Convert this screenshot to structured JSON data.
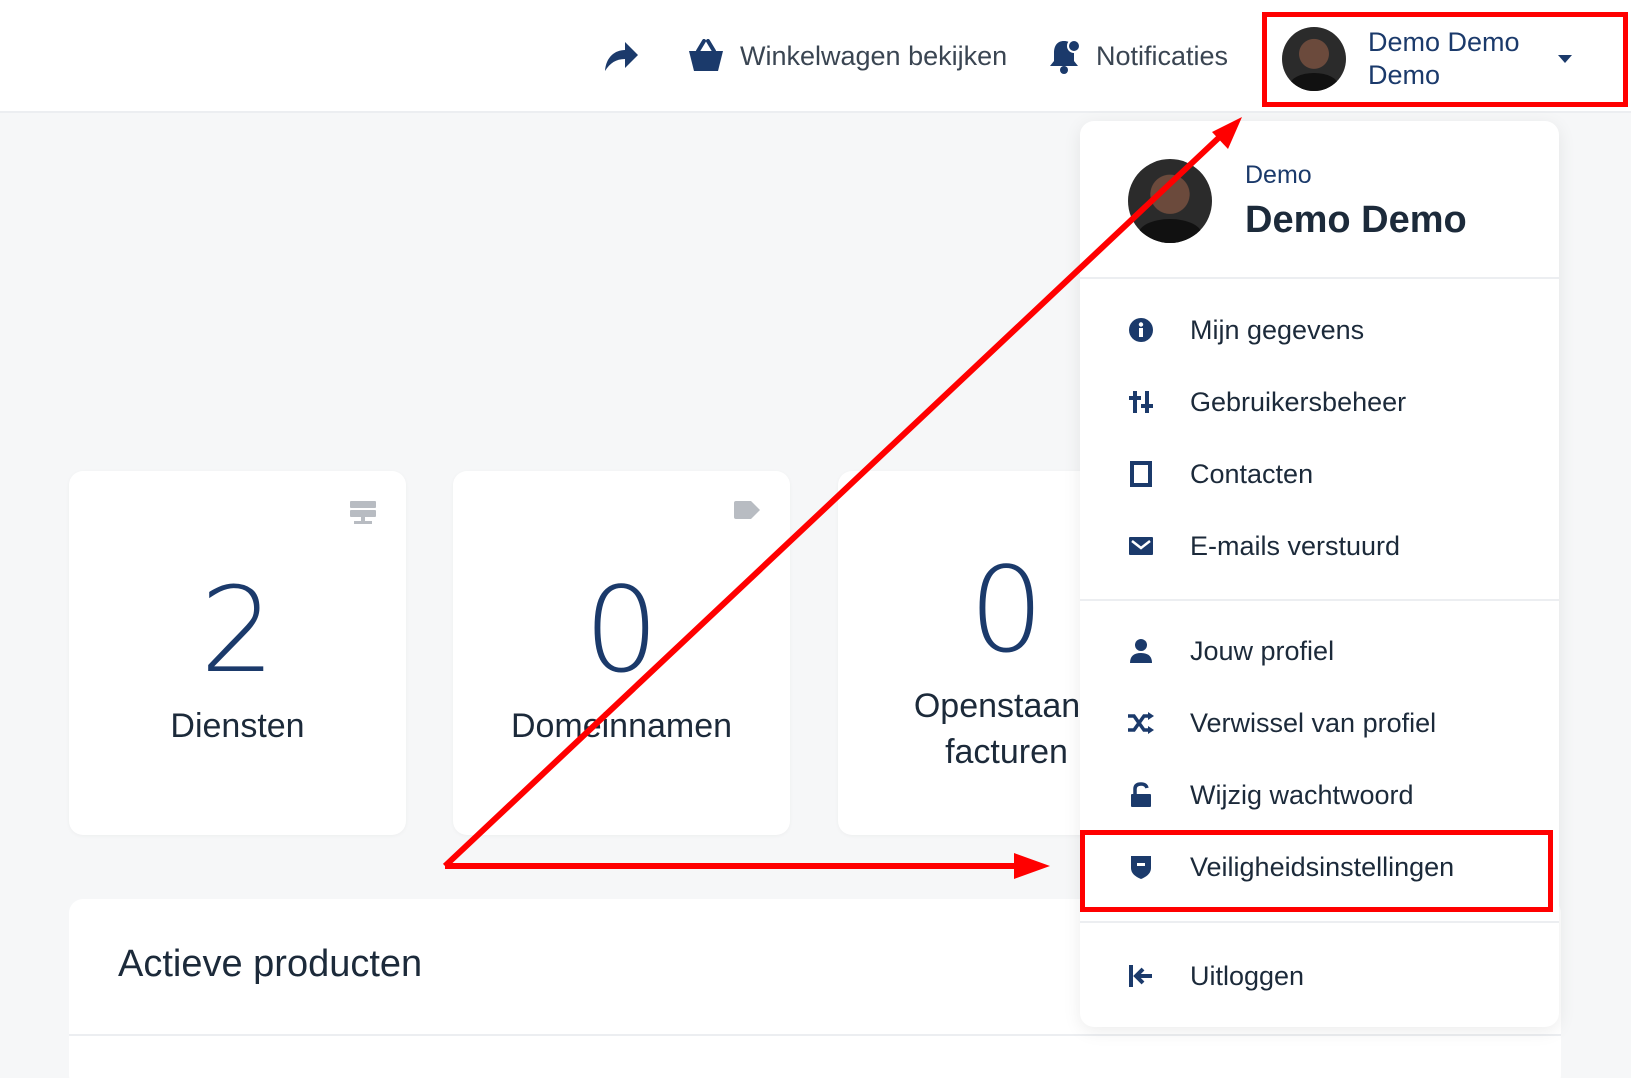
{
  "topbar": {
    "share_icon": "share-arrow-icon",
    "cart_label": "Winkelwagen bekijken",
    "cart_icon": "basket-icon",
    "notifications_label": "Notificaties",
    "notifications_icon": "bell-icon",
    "user": {
      "name_line1": "Demo Demo",
      "name_line2": "Demo",
      "avatar_icon": "avatar"
    }
  },
  "stats": [
    {
      "value": "2",
      "label": "Diensten",
      "icon": "server-icon"
    },
    {
      "value": "0",
      "label": "Domeinnamen",
      "icon": "tag-icon"
    },
    {
      "value": "0",
      "label": "Openstaande facturen",
      "label_line1": "Openstaand",
      "label_line2": "facturen"
    }
  ],
  "active_products": {
    "title": "Actieve producten"
  },
  "dropdown": {
    "subtitle": "Demo",
    "title": "Demo Demo",
    "group1": [
      {
        "label": "Mijn gegevens",
        "icon": "info-icon"
      },
      {
        "label": "Gebruikersbeheer",
        "icon": "sliders-icon"
      },
      {
        "label": "Contacten",
        "icon": "contacts-book-icon"
      },
      {
        "label": "E-mails verstuurd",
        "icon": "envelope-icon"
      }
    ],
    "group2": [
      {
        "label": "Jouw profiel",
        "icon": "user-icon"
      },
      {
        "label": "Verwissel van profiel",
        "icon": "shuffle-icon"
      },
      {
        "label": "Wijzig wachtwoord",
        "icon": "unlock-icon"
      },
      {
        "label": "Veiligheidsinstellingen",
        "icon": "shield-icon"
      }
    ],
    "logout": {
      "label": "Uitloggen",
      "icon": "logout-icon"
    }
  },
  "annotations": {
    "highlight_color": "#ff0000"
  },
  "colors": {
    "accent": "#1b3a6b",
    "background": "#f6f7f8"
  }
}
